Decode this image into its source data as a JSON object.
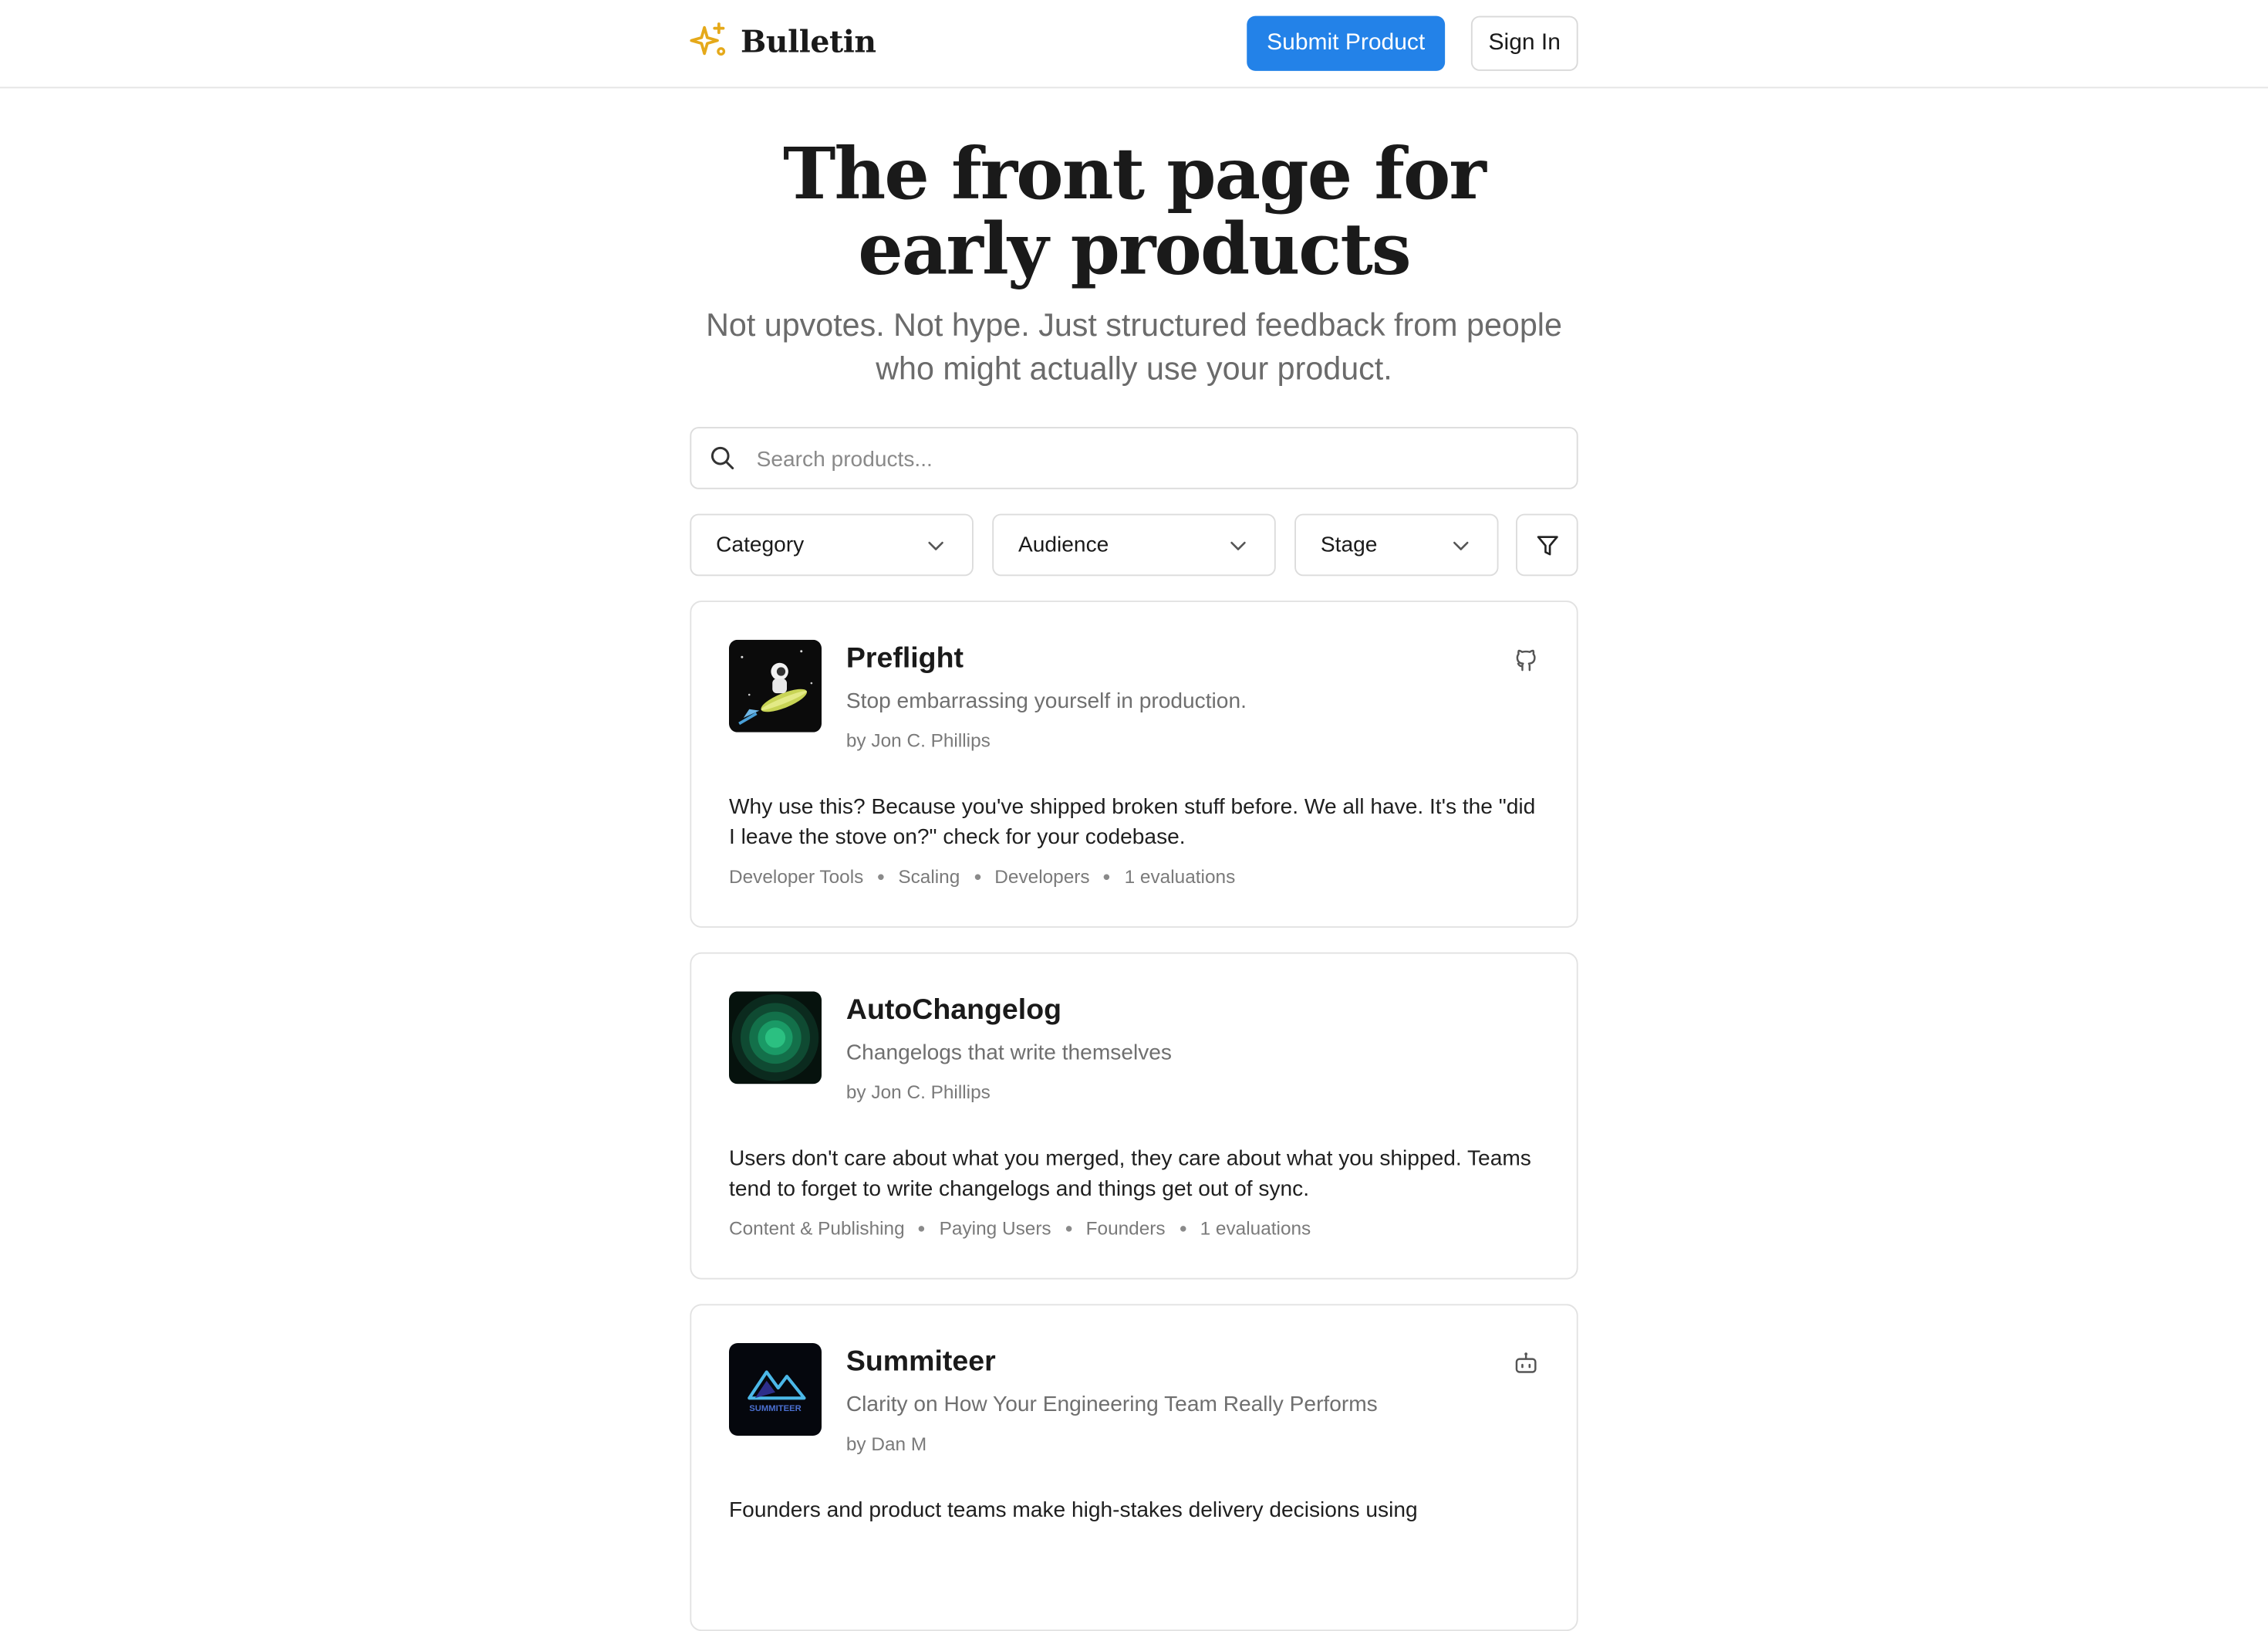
{
  "header": {
    "brand": "Bulletin",
    "submit_label": "Submit Product",
    "signin_label": "Sign In"
  },
  "hero": {
    "title": "The front page for early products",
    "subtitle": "Not upvotes. Not hype. Just structured feedback from people who might actually use your product."
  },
  "search": {
    "placeholder": "Search products...",
    "value": ""
  },
  "filters": {
    "category": "Category",
    "audience": "Audience",
    "stage": "Stage"
  },
  "colors": {
    "accent": "#2382e8",
    "brand_icon": "#e5a91a"
  },
  "products": [
    {
      "name": "Preflight",
      "tagline": "Stop embarrassing yourself in production.",
      "author": "by Jon C. Phillips",
      "badge_icon": "github-icon",
      "description": "Why use this? Because you've shipped broken stuff before. We all have. It's the \"did I leave the stove on?\" check for your codebase.",
      "meta": [
        "Developer Tools",
        "Scaling",
        "Developers",
        "1 evaluations"
      ]
    },
    {
      "name": "AutoChangelog",
      "tagline": "Changelogs that write themselves",
      "author": "by Jon C. Phillips",
      "badge_icon": "",
      "description": "Users don't care about what you merged, they care about what you shipped. Teams tend to forget to write changelogs and things get out of sync.",
      "meta": [
        "Content & Publishing",
        "Paying Users",
        "Founders",
        "1 evaluations"
      ]
    },
    {
      "name": "Summiteer",
      "tagline": "Clarity on How Your Engineering Team Really Performs",
      "author": "by Dan M",
      "badge_icon": "robot-icon",
      "description": "Founders and product teams make high-stakes delivery decisions using",
      "meta": [],
      "logo_text": "SUMMITEER"
    }
  ]
}
